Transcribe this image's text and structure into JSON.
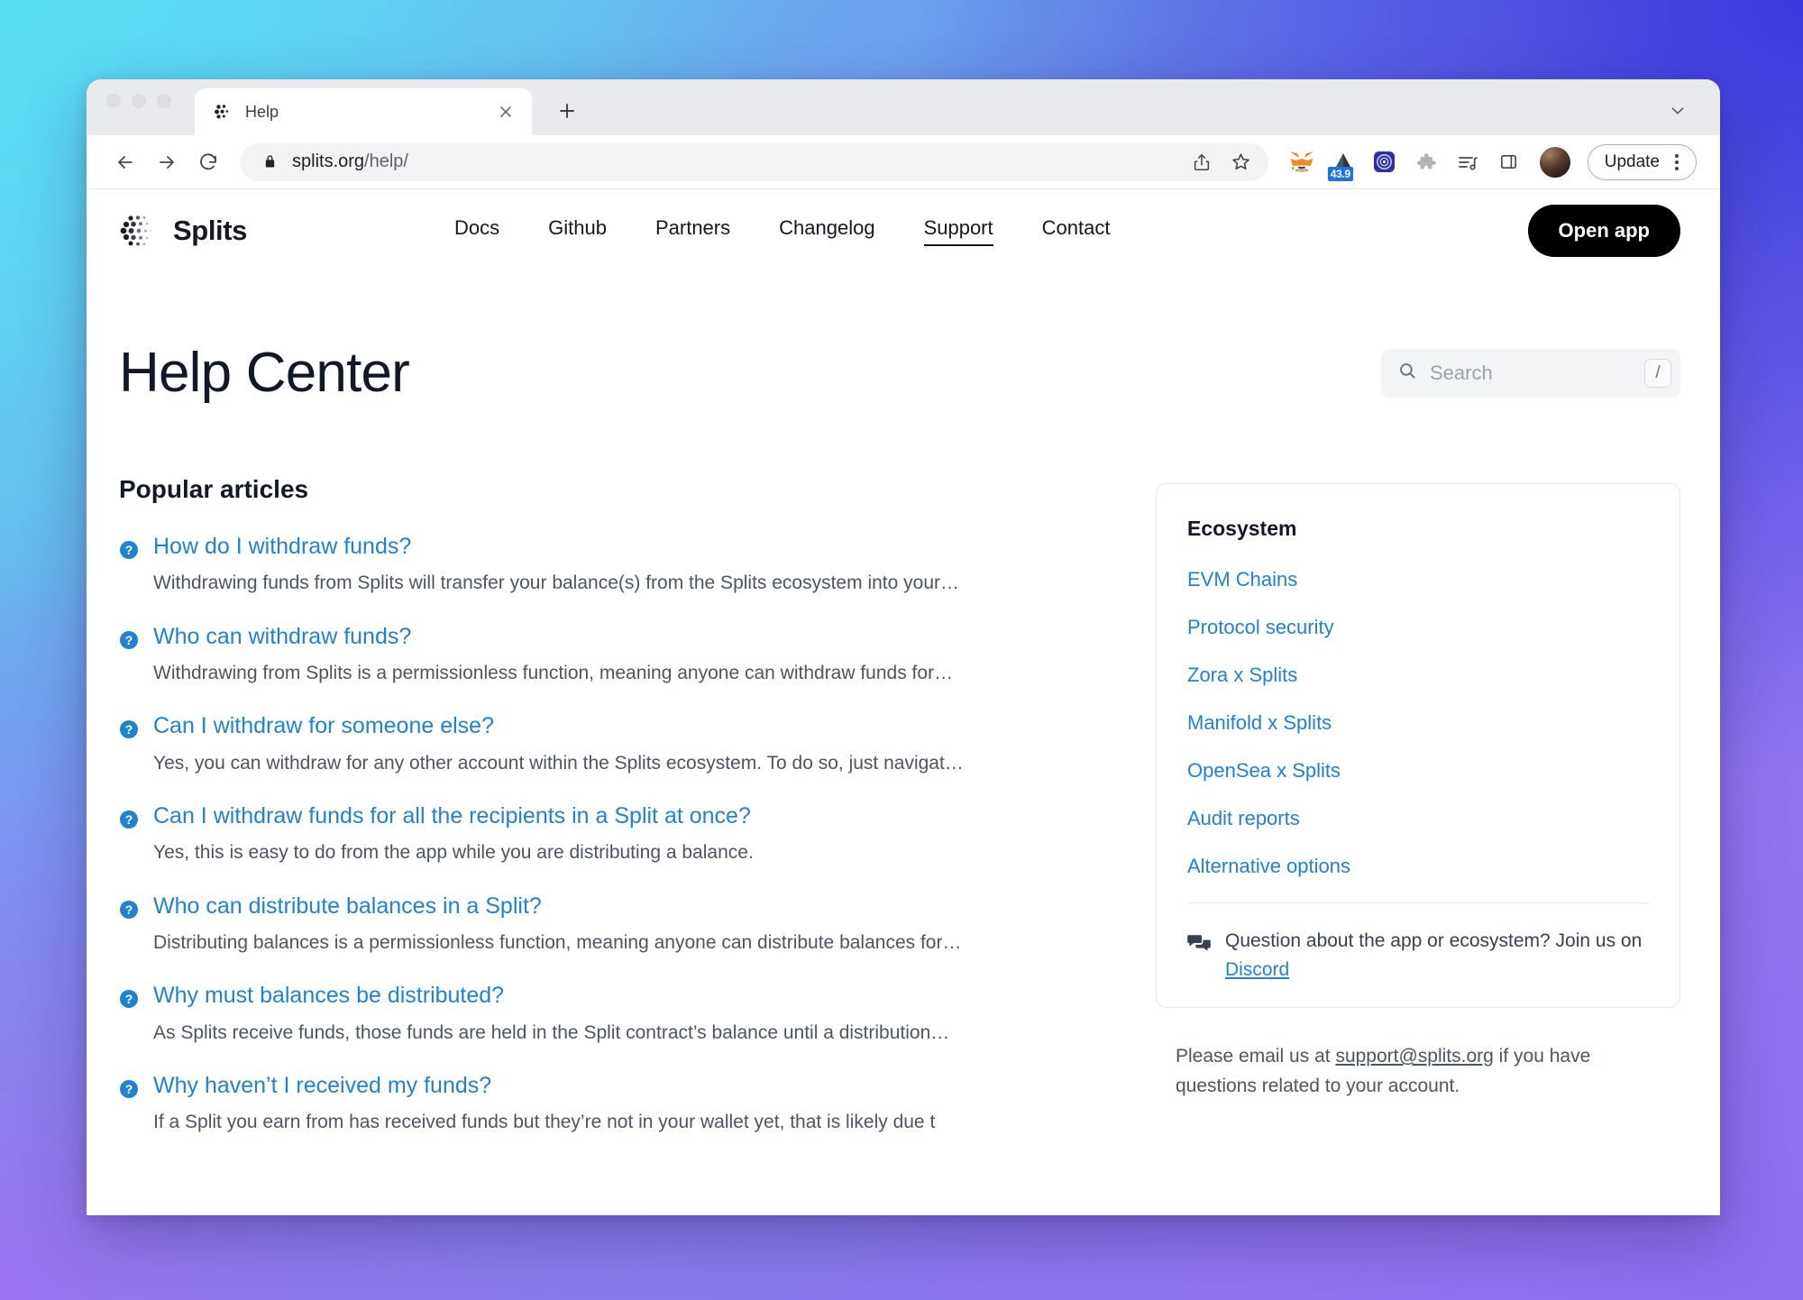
{
  "browser": {
    "tab": {
      "title": "Help",
      "favicon_icon": "splits-dots-icon",
      "close_icon": "close-icon"
    },
    "new_tab_icon": "plus-icon",
    "tabstrip_chevron_icon": "chevron-down-icon",
    "back_icon": "arrow-left-icon",
    "forward_icon": "arrow-right-icon",
    "reload_icon": "reload-icon",
    "lock_icon": "lock-icon",
    "url_domain": "splits.org",
    "url_path": "/help/",
    "share_icon": "share-icon",
    "bookmark_icon": "star-icon",
    "extensions": [
      {
        "name": "metamask-extension-icon",
        "badge": ""
      },
      {
        "name": "triangle-extension-icon",
        "badge": "43.9"
      },
      {
        "name": "blue-circle-extension-icon",
        "badge": ""
      }
    ],
    "puzzle_icon": "puzzle-icon",
    "reading_list_icon": "reading-list-icon",
    "side_panel_icon": "side-panel-icon",
    "avatar_icon": "avatar",
    "update_label": "Update",
    "menu_icon": "kebab-menu-icon"
  },
  "site": {
    "brand": "Splits",
    "logo_icon": "splits-dots-icon",
    "nav": [
      {
        "label": "Docs",
        "active": false
      },
      {
        "label": "Github",
        "active": false
      },
      {
        "label": "Partners",
        "active": false
      },
      {
        "label": "Changelog",
        "active": false
      },
      {
        "label": "Support",
        "active": true
      },
      {
        "label": "Contact",
        "active": false
      }
    ],
    "open_app_label": "Open app"
  },
  "main": {
    "page_title": "Help Center",
    "search": {
      "placeholder": "Search",
      "value": "",
      "icon": "search-icon",
      "shortcut_key": "/"
    },
    "section_heading": "Popular articles",
    "article_icon": "question-circle-icon",
    "articles": [
      {
        "title": "How do I withdraw funds?",
        "snippet": "Withdrawing funds from Splits will transfer your balance(s) from the Splits ecosystem into your…"
      },
      {
        "title": "Who can withdraw funds?",
        "snippet": "Withdrawing from Splits is a permissionless function, meaning anyone can withdraw funds for…"
      },
      {
        "title": "Can I withdraw for someone else?",
        "snippet": "Yes, you can withdraw for any other account within the Splits ecosystem. To do so, just navigat…"
      },
      {
        "title": "Can I withdraw funds for all the recipients in a Split at once?",
        "snippet": "Yes, this is easy to do from the app while you are distributing a balance."
      },
      {
        "title": "Who can distribute balances in a Split?",
        "snippet": "Distributing balances is a permissionless function, meaning anyone can distribute balances for…"
      },
      {
        "title": "Why must balances be distributed?",
        "snippet": "As Splits receive funds, those funds are held in the Split contract’s balance until a distribution…"
      },
      {
        "title": "Why haven’t I received my funds?",
        "snippet": "If a Split you earn from has received funds but they’re not in your wallet yet, that is likely due t"
      }
    ]
  },
  "sidebar": {
    "card_title": "Ecosystem",
    "links": [
      "EVM Chains",
      "Protocol security",
      "Zora x Splits",
      "Manifold x Splits",
      "OpenSea x Splits",
      "Audit reports",
      "Alternative options"
    ],
    "discord": {
      "icon": "chat-bubbles-icon",
      "text_before": "Question about the app or ecosystem? Join us on ",
      "link_label": "Discord"
    },
    "email_note": {
      "text_before": "Please email us at ",
      "link_label": "support@splits.org",
      "text_after": " if you have questions related to your account."
    }
  },
  "colors": {
    "link_blue": "#1F82D2",
    "ink": "#111827",
    "brand_black": "#000000",
    "badge_blue": "#1A73E8"
  }
}
